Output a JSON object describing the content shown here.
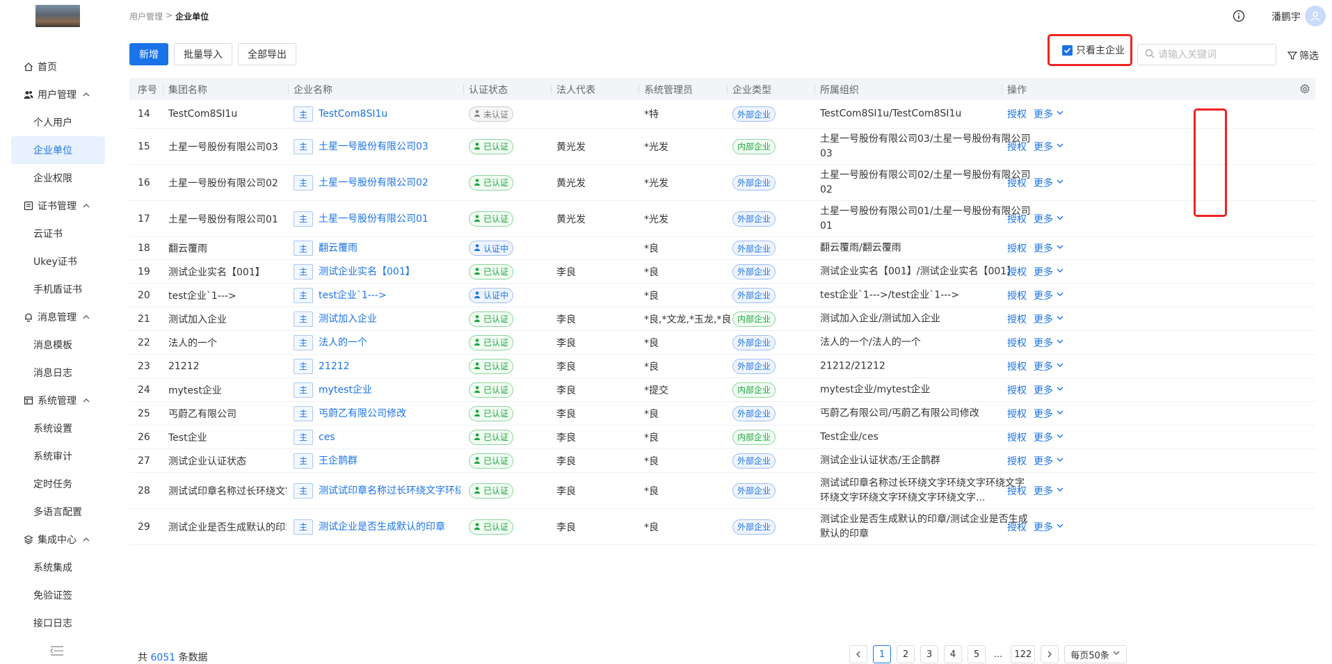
{
  "header": {
    "breadcrumb": {
      "parent": "用户管理",
      "sep": ">",
      "current": "企业单位"
    },
    "user_name": "潘鹏宇"
  },
  "sidebar": {
    "items": [
      {
        "label": "首页",
        "level": 1,
        "icon": "home-icon"
      },
      {
        "label": "用户管理",
        "level": 1,
        "icon": "users-icon",
        "expanded": true
      },
      {
        "label": "个人用户",
        "level": 2
      },
      {
        "label": "企业单位",
        "level": 2,
        "active": true
      },
      {
        "label": "企业权限",
        "level": 2
      },
      {
        "label": "证书管理",
        "level": 1,
        "icon": "certificate-icon",
        "expanded": true
      },
      {
        "label": "云证书",
        "level": 2
      },
      {
        "label": "Ukey证书",
        "level": 2
      },
      {
        "label": "手机盾证书",
        "level": 2
      },
      {
        "label": "消息管理",
        "level": 1,
        "icon": "bell-icon",
        "expanded": true
      },
      {
        "label": "消息模板",
        "level": 2
      },
      {
        "label": "消息日志",
        "level": 2
      },
      {
        "label": "系统管理",
        "level": 1,
        "icon": "system-icon",
        "expanded": true
      },
      {
        "label": "系统设置",
        "level": 2
      },
      {
        "label": "系统审计",
        "level": 2
      },
      {
        "label": "定时任务",
        "level": 2
      },
      {
        "label": "多语言配置",
        "level": 2
      },
      {
        "label": "集成中心",
        "level": 1,
        "icon": "layers-icon",
        "expanded": true
      },
      {
        "label": "系统集成",
        "level": 2
      },
      {
        "label": "免验证签",
        "level": 2
      },
      {
        "label": "接口日志",
        "level": 2
      }
    ]
  },
  "toolbar": {
    "add_label": "新增",
    "import_label": "批量导入",
    "export_label": "全部导出",
    "main_only_label": "只看主企业",
    "main_only_checked": true,
    "search_placeholder": "请输入关键词",
    "filter_label": "筛选"
  },
  "table": {
    "headers": [
      "序号",
      "集团名称",
      "企业名称",
      "认证状态",
      "法人代表",
      "系统管理员",
      "企业类型",
      "所属组织",
      "操作"
    ],
    "main_tag": "主",
    "grant_label": "授权",
    "more_label": "更多",
    "rows": [
      {
        "no": "14",
        "group": "TestCom8SI1u",
        "name": "TestCom8SI1u",
        "status": "未认证",
        "status_type": "no",
        "legal": "",
        "admin": "*特",
        "type": "外部企业",
        "type_kind": "ext",
        "org": "TestCom8SI1u/TestCom8SI1u"
      },
      {
        "no": "15",
        "group": "土星一号股份有限公司03",
        "name": "土星一号股份有限公司03",
        "status": "已认证",
        "status_type": "ok",
        "legal": "黄光发",
        "admin": "*光发",
        "type": "内部企业",
        "type_kind": "int",
        "org": "土星一号股份有限公司03/土星一号股份有限公司03"
      },
      {
        "no": "16",
        "group": "土星一号股份有限公司02",
        "name": "土星一号股份有限公司02",
        "status": "已认证",
        "status_type": "ok",
        "legal": "黄光发",
        "admin": "*光发",
        "type": "外部企业",
        "type_kind": "ext",
        "org": "土星一号股份有限公司02/土星一号股份有限公司02"
      },
      {
        "no": "17",
        "group": "土星一号股份有限公司01",
        "name": "土星一号股份有限公司01",
        "status": "已认证",
        "status_type": "ok",
        "legal": "黄光发",
        "admin": "*光发",
        "type": "外部企业",
        "type_kind": "ext",
        "org": "土星一号股份有限公司01/土星一号股份有限公司01"
      },
      {
        "no": "18",
        "group": "翻云覆雨",
        "name": "翻云覆雨",
        "status": "认证中",
        "status_type": "ing",
        "legal": "",
        "admin": "*良",
        "type": "外部企业",
        "type_kind": "ext",
        "org": "翻云覆雨/翻云覆雨"
      },
      {
        "no": "19",
        "group": "测试企业实名【001】",
        "name": "测试企业实名【001】",
        "status": "已认证",
        "status_type": "ok",
        "legal": "李良",
        "admin": "*良",
        "type": "外部企业",
        "type_kind": "ext",
        "org": "测试企业实名【001】/测试企业实名【001】"
      },
      {
        "no": "20",
        "group": "test企业`1--->",
        "name": "test企业`1--->",
        "status": "认证中",
        "status_type": "ing",
        "legal": "",
        "admin": "*良",
        "type": "外部企业",
        "type_kind": "ext",
        "org": "test企业`1--->/test企业`1--->"
      },
      {
        "no": "21",
        "group": "测试加入企业",
        "name": "测试加入企业",
        "status": "已认证",
        "status_type": "ok",
        "legal": "李良",
        "admin": "*良,*文龙,*玉龙,*良",
        "type": "内部企业",
        "type_kind": "int",
        "org": "测试加入企业/测试加入企业"
      },
      {
        "no": "22",
        "group": "法人的一个",
        "name": "法人的一个",
        "status": "已认证",
        "status_type": "ok",
        "legal": "李良",
        "admin": "*良",
        "type": "外部企业",
        "type_kind": "ext",
        "org": "法人的一个/法人的一个"
      },
      {
        "no": "23",
        "group": "21212",
        "name": "21212",
        "status": "已认证",
        "status_type": "ok",
        "legal": "李良",
        "admin": "*良",
        "type": "外部企业",
        "type_kind": "ext",
        "org": "21212/21212"
      },
      {
        "no": "24",
        "group": "mytest企业",
        "name": "mytest企业",
        "status": "已认证",
        "status_type": "ok",
        "legal": "李良",
        "admin": "*提交",
        "type": "内部企业",
        "type_kind": "int",
        "org": "mytest企业/mytest企业"
      },
      {
        "no": "25",
        "group": "丐蔚乙有限公司",
        "name": "丐蔚乙有限公司修改",
        "status": "已认证",
        "status_type": "ok",
        "legal": "李良",
        "admin": "*良",
        "type": "外部企业",
        "type_kind": "ext",
        "org": "丐蔚乙有限公司/丐蔚乙有限公司修改"
      },
      {
        "no": "26",
        "group": "Test企业",
        "name": "ces",
        "status": "已认证",
        "status_type": "ok",
        "legal": "李良",
        "admin": "*良",
        "type": "内部企业",
        "type_kind": "int",
        "org": "Test企业/ces"
      },
      {
        "no": "27",
        "group": "测试企业认证状态",
        "name": "王企鹊群",
        "status": "已认证",
        "status_type": "ok",
        "legal": "李良",
        "admin": "*良",
        "type": "外部企业",
        "type_kind": "ext",
        "org": "测试企业认证状态/王企鹊群"
      },
      {
        "no": "28",
        "group": "测试试印章名称过长环绕文字...",
        "name": "测试试印章名称过长环绕文字环绕文...",
        "status": "已认证",
        "status_type": "ok",
        "legal": "李良",
        "admin": "*良",
        "type": "外部企业",
        "type_kind": "ext",
        "org": "测试试印章名称过长环绕文字环绕文字环绕文字环绕文字环绕文字环绕文字环绕文字..."
      },
      {
        "no": "29",
        "group": "测试企业是否生成默认的印章",
        "name": "测试企业是否生成默认的印章",
        "status": "已认证",
        "status_type": "ok",
        "legal": "李良",
        "admin": "*良",
        "type": "外部企业",
        "type_kind": "ext",
        "org": "测试企业是否生成默认的印章/测试企业是否生成默认的印章"
      }
    ]
  },
  "footer": {
    "total_prefix": "共",
    "total_count": "6051",
    "total_suffix": "条数据",
    "pages": [
      "1",
      "2",
      "3",
      "4",
      "5"
    ],
    "current_page": "1",
    "ellipsis": "...",
    "last_page": "122",
    "page_size_label": "每页50条"
  },
  "colors": {
    "primary": "#1a73e8",
    "highlight": "#ee2222",
    "success": "#1fa33e"
  }
}
